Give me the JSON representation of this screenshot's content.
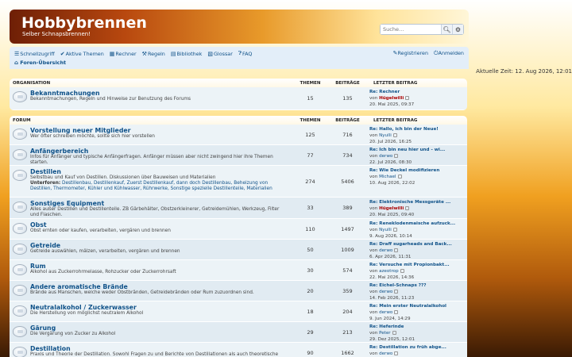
{
  "site": {
    "title": "Hobbybrennen",
    "subtitle": "Selber Schnapsbrennen!"
  },
  "search": {
    "placeholder": "Suche…"
  },
  "nav": {
    "quicklinks": "Schnellzugriff",
    "active": "Aktive Themen",
    "calculator": "Rechner",
    "rules": "Regeln",
    "library": "Bibliothek",
    "glossary": "Glossar",
    "faq": "FAQ",
    "register": "Registrieren",
    "login": "Anmelden",
    "breadcrumb": "Foren-Übersicht"
  },
  "time": "Aktuelle Zeit: 12. Aug 2026, 12:01",
  "columns": {
    "topics": "THEMEN",
    "posts": "BEITRÄGE",
    "last": "LETZTER BEITRAG"
  },
  "sections": [
    {
      "title": "ORGANISATION",
      "forums": [
        {
          "name": "Bekanntmachungen",
          "desc": "Bekanntmachungen, Regeln und Hinweise zur Benutzung des Forums",
          "topics": "15",
          "posts": "135",
          "last": {
            "title": "Re: Rechner",
            "by": "von",
            "user": "Hügelwilli",
            "date": "20. Mai 2025, 09:37"
          }
        }
      ]
    },
    {
      "title": "FORUM",
      "forums": [
        {
          "name": "Vorstellung neuer Mitglieder",
          "desc": "Wer öfter schreiben möchte, sollte sich hier vorstellen",
          "topics": "125",
          "posts": "716",
          "last": {
            "title": "Re: Hallo, ich bin der Neue!",
            "by": "von",
            "user": "Nyulli",
            "date": "20. Jul 2026, 16:25"
          }
        },
        {
          "name": "Anfängerbereich",
          "desc": "Infos für Anfänger und typische Anfängerfragen. Anfänger müssen aber nicht zwingend hier ihre Themen starten.",
          "topics": "77",
          "posts": "734",
          "last": {
            "title": "Re: Ich bin neu hier und - wi...",
            "by": "von",
            "user": "derwo",
            "date": "22. Jul 2026, 08:30"
          }
        },
        {
          "name": "Destillen",
          "desc": "Selbstbau und Kauf von Destillen. Diskussionen über Bauweisen und Materialien",
          "sub_label": "Unterforen:",
          "sub": "Destillenbau, Destillenkauf, Zuerst Destillenkauf, dann doch Destillenbau, Beheizung von Destillen, Thermometer, Kühler und Kühlwasser, Rührwerke, Sonstige spezielle Destillenteile, Materialien",
          "topics": "274",
          "posts": "5406",
          "last": {
            "title": "Re: Wie Deckel modifizieren",
            "by": "von",
            "user": "Michael",
            "date": "10. Aug 2026, 22:02"
          }
        },
        {
          "name": "Sonstiges Equipment",
          "desc": "Alles außer Destillen und Destillenteile. ZB Gärbehälter, Obstzerkleinerer, Getreidemühlen, Werkzeug, Filter und Flaschen.",
          "topics": "33",
          "posts": "389",
          "last": {
            "title": "Re: Elektronische Messgeräte ...",
            "by": "von",
            "user": "Hügelwilli",
            "date": "20. Mai 2025, 09:40"
          }
        },
        {
          "name": "Obst",
          "desc": "Obst ernten oder kaufen, verarbeiten, vergären und brennen",
          "topics": "110",
          "posts": "1497",
          "last": {
            "title": "Re: Reneklodenmaische aufzuck...",
            "by": "von",
            "user": "Nyulli",
            "date": "9. Aug 2026, 10:14"
          }
        },
        {
          "name": "Getreide",
          "desc": "Getreide auswählen, mälzen, verarbeiten, vergären und brennen",
          "topics": "50",
          "posts": "1009",
          "last": {
            "title": "Re: Draff sugarheads and Back...",
            "by": "von",
            "user": "derwo",
            "date": "6. Apr 2026, 11:31"
          }
        },
        {
          "name": "Rum",
          "desc": "Alkohol aus Zuckerrohrmelasse, Rohzucker oder Zuckerrohrsaft",
          "topics": "30",
          "posts": "574",
          "last": {
            "title": "Re: Versuche mit Propionbakt...",
            "by": "von",
            "user": "azeotrop",
            "date": "22. Mai 2026, 14:36"
          }
        },
        {
          "name": "Andere aromatische Brände",
          "desc": "Brände aus Manschen, welche weder Obstbränden, Getreidebränden oder Rum zuzuordnen sind.",
          "topics": "20",
          "posts": "359",
          "last": {
            "title": "Re: Eichel-Schnaps ???",
            "by": "von",
            "user": "derwo",
            "date": "14. Feb 2026, 11:23"
          }
        },
        {
          "name": "Neutralalkohol / Zuckerwasser",
          "desc": "Die Herstellung von möglichst neutralem Alkohol",
          "topics": "18",
          "posts": "204",
          "last": {
            "title": "Re: Mein erster Neutralalkohol",
            "by": "von",
            "user": "derwo",
            "date": "9. Jun 2024, 14:29"
          }
        },
        {
          "name": "Gärung",
          "desc": "Die Vergärung von Zucker zu Alkohol",
          "topics": "29",
          "posts": "213",
          "last": {
            "title": "Re: Heferinde",
            "by": "von",
            "user": "Peter",
            "date": "29. Dez 2025, 12:01"
          }
        },
        {
          "name": "Destillation",
          "desc": "Praxis und Theorie der Destillation. Sowohl Fragen zu und Berichte von Destillationen als auch theoretische",
          "topics": "90",
          "posts": "1662",
          "last": {
            "title": "Re: Destillation zu früh abge...",
            "by": "von",
            "user": "derwo",
            "date": ""
          }
        }
      ]
    }
  ]
}
